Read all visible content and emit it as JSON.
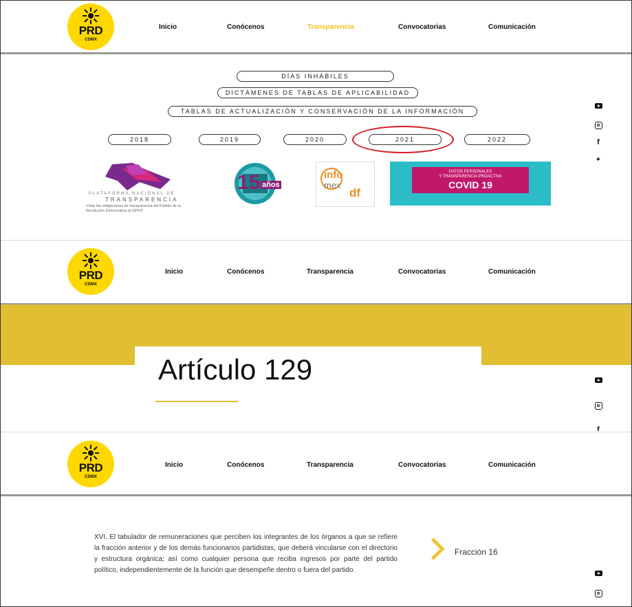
{
  "brand": {
    "prd": "PRD",
    "cdmx": "CDMX"
  },
  "nav": [
    {
      "label": "Inicio"
    },
    {
      "label": "Conócenos"
    },
    {
      "label": "Transparencia"
    },
    {
      "label": "Convocatorias"
    },
    {
      "label": "Comunicación"
    }
  ],
  "buttons": {
    "dias_inhabiles": "DÍAS INHÁBILES",
    "dictamenes": "DICTÁMENES DE TABLAS DE APLICABILIDAD",
    "tablas": "TABLAS DE ACTUALIZACIÓN Y CONSERVACIÓN DE LA INFORMACIÓN",
    "years": [
      "2018",
      "2019",
      "2020",
      "2021",
      "2022"
    ]
  },
  "tiles": {
    "pnt_title": "PLATAFORMA NACIONAL DE",
    "pnt_sub": "TRANSPARENCIA",
    "pnt_caption": "Visita las obligaciones de transparencia del Partido de la Revolución Democrática al SIPOT",
    "aniv_number": "15",
    "aniv_text": "años",
    "infomex_info": "info",
    "infomex_mex": "mex",
    "infomex_df": "df",
    "covid_line1": "DATOS PERSONALES",
    "covid_line2": "Y TRANSPARENCIA PROACTIVA",
    "covid_line3": "COVID 19"
  },
  "articulo": {
    "title": "Artículo 129"
  },
  "fraccion": {
    "text": "XVI. El tabulador de remuneraciones que perciben los integrantes de los órganos a que se refiere la fracción anterior y de los demás funcionarios partidistas, que deberá vincularse con el directorio y estructura orgánica; así como cualquier persona que reciba ingresos por parte del partido político, independientemente de la función que desempeñe dentro o fuera del partido.",
    "label": "Fracción 16"
  },
  "social": [
    "youtube-icon",
    "instagram-icon",
    "facebook-icon",
    "twitter-icon"
  ],
  "colors": {
    "accent": "#f4c31a",
    "logo_yellow": "#ffd800",
    "highlight": "#d5191f",
    "band": "#e1be32"
  }
}
